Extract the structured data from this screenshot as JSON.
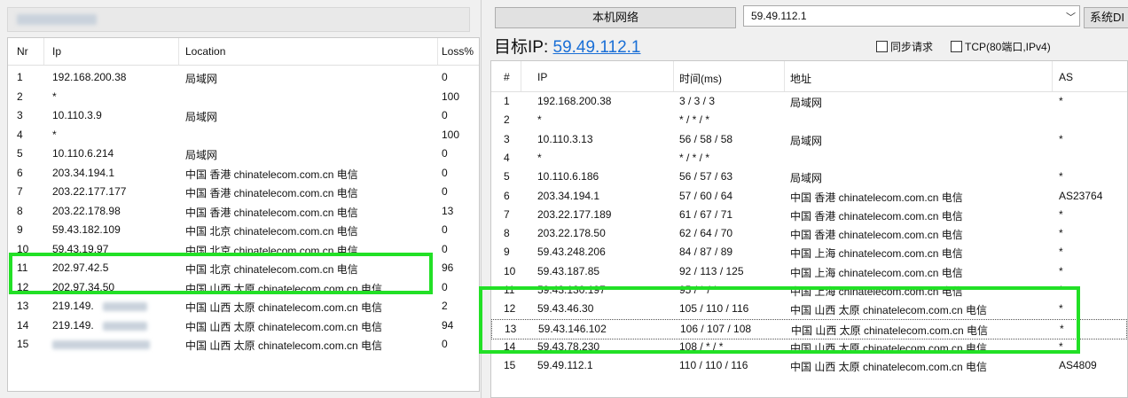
{
  "left": {
    "columns": [
      "Nr",
      "Ip",
      "Location",
      "Loss%"
    ],
    "rows": [
      {
        "nr": "1",
        "ip": "192.168.200.38",
        "location": "局域网",
        "loss": "0"
      },
      {
        "nr": "2",
        "ip": "*",
        "location": "",
        "loss": "100"
      },
      {
        "nr": "3",
        "ip": "10.110.3.9",
        "location": "局域网",
        "loss": "0"
      },
      {
        "nr": "4",
        "ip": "*",
        "location": "",
        "loss": "100"
      },
      {
        "nr": "5",
        "ip": "10.110.6.214",
        "location": "局域网",
        "loss": "0"
      },
      {
        "nr": "6",
        "ip": "203.34.194.1",
        "location": "中国 香港 chinatelecom.com.cn 电信",
        "loss": "0"
      },
      {
        "nr": "7",
        "ip": "203.22.177.177",
        "location": "中国 香港 chinatelecom.com.cn 电信",
        "loss": "0"
      },
      {
        "nr": "8",
        "ip": "203.22.178.98",
        "location": "中国 香港 chinatelecom.com.cn 电信",
        "loss": "13"
      },
      {
        "nr": "9",
        "ip": "59.43.182.109",
        "location": "中国 北京 chinatelecom.com.cn 电信",
        "loss": "0"
      },
      {
        "nr": "10",
        "ip": "59.43.19.97",
        "location": "中国 北京 chinatelecom.com.cn 电信",
        "loss": "0"
      },
      {
        "nr": "11",
        "ip": "202.97.42.5",
        "location": "中国 北京 chinatelecom.com.cn 电信",
        "loss": "96"
      },
      {
        "nr": "12",
        "ip": "202.97.34.50",
        "location": "中国 山西 太原 chinatelecom.com.cn 电信",
        "loss": "0"
      },
      {
        "nr": "13",
        "ip": "219.149.",
        "location": "中国 山西 太原 chinatelecom.com.cn 电信",
        "loss": "2"
      },
      {
        "nr": "14",
        "ip": "219.149.",
        "location": "中国 山西 太原 chinatelecom.com.cn 电信",
        "loss": "94"
      },
      {
        "nr": "15",
        "ip": "",
        "location": "中国 山西 太原 chinatelecom.com.cn 电信",
        "loss": "0"
      }
    ]
  },
  "right": {
    "local_network_button": "本机网络",
    "target_combo_value": "59.49.112.1",
    "dns_button": "系统DI",
    "target_label": "目标IP:",
    "target_ip": "59.49.112.1",
    "sync_request_label": "同步请求",
    "tcp_label": "TCP(80端口,IPv4)",
    "columns": [
      "#",
      "IP",
      "时间(ms)",
      "地址",
      "AS"
    ],
    "rows": [
      {
        "nr": "1",
        "ip": "192.168.200.38",
        "time": "3 / 3 / 3",
        "addr": "局域网",
        "as": "*"
      },
      {
        "nr": "2",
        "ip": "*",
        "time": "* / * / *",
        "addr": "",
        "as": ""
      },
      {
        "nr": "3",
        "ip": "10.110.3.13",
        "time": "56 / 58 / 58",
        "addr": "局域网",
        "as": "*"
      },
      {
        "nr": "4",
        "ip": "*",
        "time": "* / * / *",
        "addr": "",
        "as": ""
      },
      {
        "nr": "5",
        "ip": "10.110.6.186",
        "time": "56 / 57 / 63",
        "addr": "局域网",
        "as": "*"
      },
      {
        "nr": "6",
        "ip": "203.34.194.1",
        "time": "57 / 60 / 64",
        "addr": "中国 香港 chinatelecom.com.cn 电信",
        "as": "AS23764"
      },
      {
        "nr": "7",
        "ip": "203.22.177.189",
        "time": "61 / 67 / 71",
        "addr": "中国 香港 chinatelecom.com.cn 电信",
        "as": "*"
      },
      {
        "nr": "8",
        "ip": "203.22.178.50",
        "time": "62 / 64 / 70",
        "addr": "中国 香港 chinatelecom.com.cn 电信",
        "as": "*"
      },
      {
        "nr": "9",
        "ip": "59.43.248.206",
        "time": "84 / 87 / 89",
        "addr": "中国 上海 chinatelecom.com.cn 电信",
        "as": "*"
      },
      {
        "nr": "10",
        "ip": "59.43.187.85",
        "time": "92 / 113 / 125",
        "addr": "中国 上海 chinatelecom.com.cn 电信",
        "as": "*"
      },
      {
        "nr": "11",
        "ip": "59.43.130.197",
        "time": "95 / * / *",
        "addr": "中国 上海 chinatelecom.com.cn 电信",
        "as": "*"
      },
      {
        "nr": "12",
        "ip": "59.43.46.30",
        "time": "105 / 110 / 116",
        "addr": "中国 山西 太原 chinatelecom.com.cn 电信",
        "as": "*"
      },
      {
        "nr": "13",
        "ip": "59.43.146.102",
        "time": "106 / 107 / 108",
        "addr": "中国 山西 太原 chinatelecom.com.cn 电信",
        "as": "*"
      },
      {
        "nr": "14",
        "ip": "59.43.78.230",
        "time": "108 / * / *",
        "addr": "中国 山西 太原 chinatelecom.com.cn 电信",
        "as": "*"
      },
      {
        "nr": "15",
        "ip": "59.49.112.1",
        "time": "110 / 110 / 116",
        "addr": "中国 山西 太原 chinatelecom.com.cn 电信",
        "as": "AS4809"
      }
    ]
  },
  "highlight_color": "#22e026",
  "link_color": "#1a6fd6"
}
